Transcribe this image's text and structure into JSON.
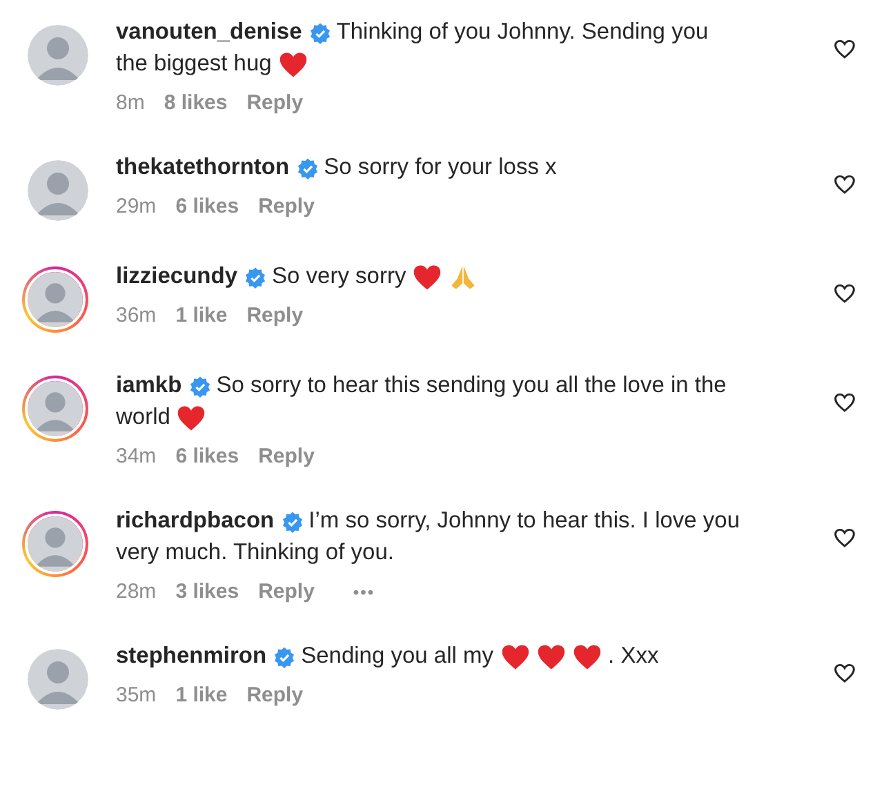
{
  "comments": [
    {
      "username": "vanouten_denise",
      "verified": true,
      "story_ring": false,
      "lines": [
        [
          {
            "kind": "text",
            "text": "Thinking of you Johnny. Sending you"
          }
        ],
        [
          {
            "kind": "text",
            "text": "the biggest hug"
          },
          {
            "kind": "heart"
          }
        ]
      ],
      "time": "8m",
      "likes": "8 likes",
      "reply": "Reply"
    },
    {
      "username": "thekatethornton",
      "verified": true,
      "story_ring": false,
      "lines": [
        [
          {
            "kind": "text",
            "text": "So sorry for your loss x"
          }
        ]
      ],
      "time": "29m",
      "likes": "6 likes",
      "reply": "Reply"
    },
    {
      "username": "lizziecundy",
      "verified": true,
      "story_ring": true,
      "lines": [
        [
          {
            "kind": "text",
            "text": "So very sorry"
          },
          {
            "kind": "heart"
          },
          {
            "kind": "pray"
          }
        ]
      ],
      "time": "36m",
      "likes": "1 like",
      "reply": "Reply"
    },
    {
      "username": "iamkb",
      "verified": true,
      "story_ring": true,
      "lines": [
        [
          {
            "kind": "text",
            "text": "So sorry to hear this sending you all the love in the"
          }
        ],
        [
          {
            "kind": "text",
            "text": "world"
          },
          {
            "kind": "heart"
          }
        ]
      ],
      "time": "34m",
      "likes": "6 likes",
      "reply": "Reply"
    },
    {
      "username": "richardpbacon",
      "verified": true,
      "story_ring": true,
      "lines": [
        [
          {
            "kind": "text",
            "text": "I’m so sorry, Johnny to hear this. I love you"
          }
        ],
        [
          {
            "kind": "text",
            "text": "very much. Thinking of you."
          }
        ]
      ],
      "time": "28m",
      "likes": "3 likes",
      "reply": "Reply",
      "more": "•••"
    },
    {
      "username": "stephenmiron",
      "verified": true,
      "story_ring": false,
      "lines": [
        [
          {
            "kind": "text",
            "text": "Sending you all my"
          },
          {
            "kind": "heart"
          },
          {
            "kind": "heart"
          },
          {
            "kind": "heart"
          },
          {
            "kind": "text",
            "text": ". Xxx"
          }
        ]
      ],
      "time": "35m",
      "likes": "1 like",
      "reply": "Reply"
    }
  ]
}
